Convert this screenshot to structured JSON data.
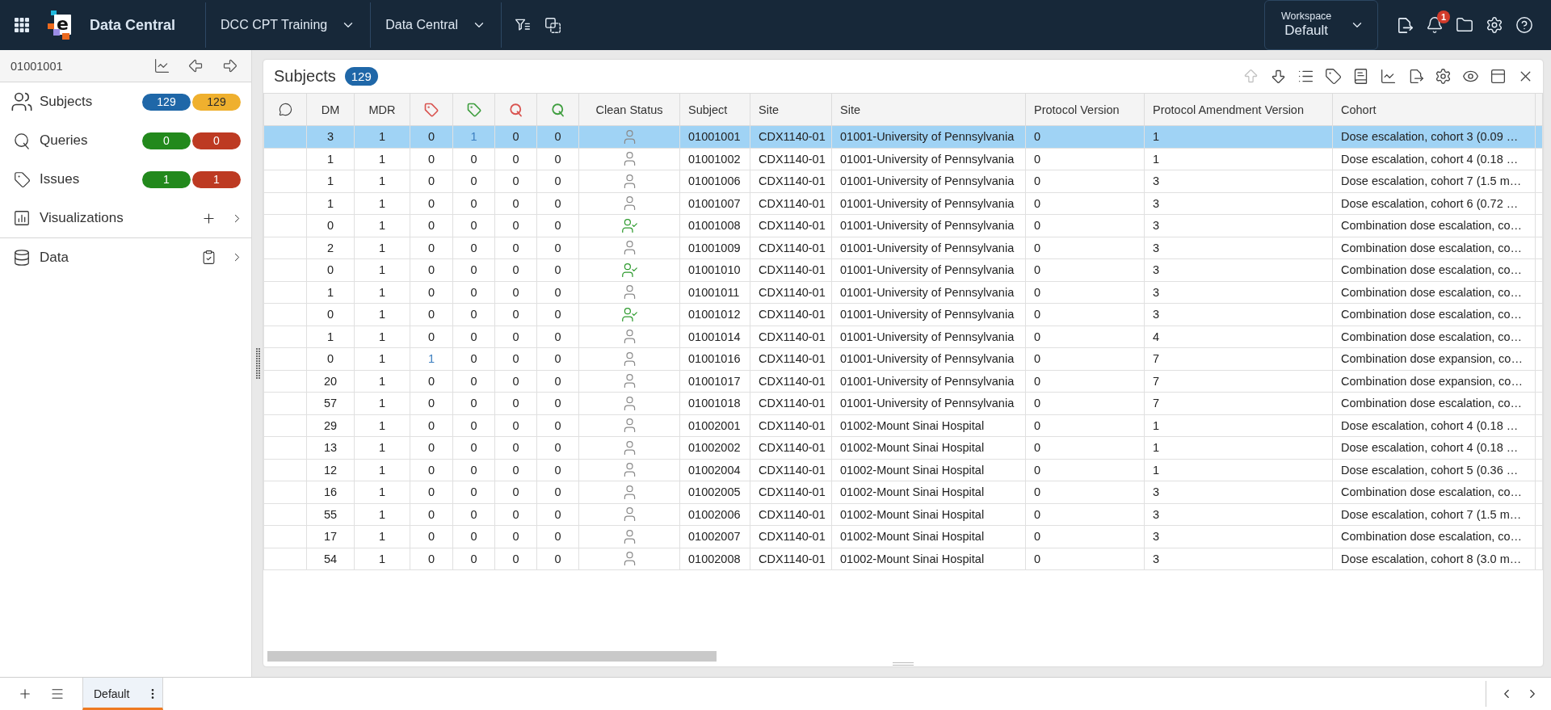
{
  "topbar": {
    "logo_letter": "e",
    "app_name": "Data Central",
    "menus": [
      {
        "label": "DCC CPT Training"
      },
      {
        "label": "Data Central"
      }
    ],
    "workspace": {
      "caption": "Workspace",
      "value": "Default"
    },
    "notification_count": "1"
  },
  "sidebar": {
    "subject_id": "01001001",
    "items": [
      {
        "kind": "subjects",
        "label": "Subjects",
        "badges": [
          {
            "value": "129",
            "color": "#1f67a8"
          },
          {
            "value": "129",
            "color": "#efb02e"
          }
        ]
      },
      {
        "kind": "queries",
        "label": "Queries",
        "badges": [
          {
            "value": "0",
            "color": "#22891c"
          },
          {
            "value": "0",
            "color": "#bd3a22"
          }
        ]
      },
      {
        "kind": "issues",
        "label": "Issues",
        "badges": [
          {
            "value": "1",
            "color": "#22891c"
          },
          {
            "value": "1",
            "color": "#bd3a22"
          }
        ]
      },
      {
        "kind": "visualizations",
        "label": "Visualizations"
      },
      {
        "kind": "data",
        "label": "Data"
      }
    ]
  },
  "panel": {
    "title": "Subjects",
    "count": "129",
    "toolbar": [
      {
        "kind": "up",
        "disabled": true
      },
      {
        "kind": "down",
        "disabled": false
      },
      {
        "kind": "list",
        "disabled": false
      },
      {
        "kind": "tag",
        "disabled": false
      },
      {
        "kind": "book",
        "disabled": false
      },
      {
        "kind": "chart",
        "disabled": false
      },
      {
        "kind": "export",
        "disabled": false
      },
      {
        "kind": "settings",
        "disabled": false
      },
      {
        "kind": "eye",
        "disabled": false
      },
      {
        "kind": "layout",
        "disabled": false
      },
      {
        "kind": "close",
        "disabled": false
      }
    ],
    "table": {
      "columns": [
        {
          "kind": "comment"
        },
        {
          "kind": "text",
          "label": "DM"
        },
        {
          "kind": "text",
          "label": "MDR"
        },
        {
          "kind": "tag",
          "color": "#d9534f"
        },
        {
          "kind": "tag",
          "color": "#3f9e3f"
        },
        {
          "kind": "query",
          "color": "#d9534f"
        },
        {
          "kind": "query",
          "color": "#3f9e3f"
        },
        {
          "kind": "text",
          "label": "Clean Status"
        },
        {
          "kind": "text",
          "label": "Subject"
        },
        {
          "kind": "text",
          "label": "Site"
        },
        {
          "kind": "text",
          "label": "Site"
        },
        {
          "kind": "text",
          "label": "Protocol Version"
        },
        {
          "kind": "text",
          "label": "Protocol Amendment Version"
        },
        {
          "kind": "text",
          "label": "Cohort"
        }
      ],
      "rows": [
        {
          "selected": true,
          "dm": "3",
          "mdr": "1",
          "counts": [
            {
              "value": "0",
              "link": false
            },
            {
              "value": "1",
              "link": true
            },
            {
              "value": "0",
              "link": false
            },
            {
              "value": "0",
              "link": false
            }
          ],
          "clean": false,
          "subject": "01001001",
          "site": "CDX1140-01",
          "site_name": "01001-University of Pennsylvania",
          "protocol_version": "0",
          "amendment_version": "1",
          "cohort": "Dose escalation, cohort 3 (0.09 …"
        },
        {
          "selected": false,
          "dm": "1",
          "mdr": "1",
          "counts": [
            {
              "value": "0",
              "link": false
            },
            {
              "value": "0",
              "link": false
            },
            {
              "value": "0",
              "link": false
            },
            {
              "value": "0",
              "link": false
            }
          ],
          "clean": false,
          "subject": "01001002",
          "site": "CDX1140-01",
          "site_name": "01001-University of Pennsylvania",
          "protocol_version": "0",
          "amendment_version": "1",
          "cohort": "Dose escalation, cohort 4 (0.18 …"
        },
        {
          "selected": false,
          "dm": "1",
          "mdr": "1",
          "counts": [
            {
              "value": "0",
              "link": false
            },
            {
              "value": "0",
              "link": false
            },
            {
              "value": "0",
              "link": false
            },
            {
              "value": "0",
              "link": false
            }
          ],
          "clean": false,
          "subject": "01001006",
          "site": "CDX1140-01",
          "site_name": "01001-University of Pennsylvania",
          "protocol_version": "0",
          "amendment_version": "3",
          "cohort": "Dose escalation, cohort 7 (1.5 m…"
        },
        {
          "selected": false,
          "dm": "1",
          "mdr": "1",
          "counts": [
            {
              "value": "0",
              "link": false
            },
            {
              "value": "0",
              "link": false
            },
            {
              "value": "0",
              "link": false
            },
            {
              "value": "0",
              "link": false
            }
          ],
          "clean": false,
          "subject": "01001007",
          "site": "CDX1140-01",
          "site_name": "01001-University of Pennsylvania",
          "protocol_version": "0",
          "amendment_version": "3",
          "cohort": "Dose escalation, cohort 6 (0.72 …"
        },
        {
          "selected": false,
          "dm": "0",
          "mdr": "1",
          "counts": [
            {
              "value": "0",
              "link": false
            },
            {
              "value": "0",
              "link": false
            },
            {
              "value": "0",
              "link": false
            },
            {
              "value": "0",
              "link": false
            }
          ],
          "clean": true,
          "subject": "01001008",
          "site": "CDX1140-01",
          "site_name": "01001-University of Pennsylvania",
          "protocol_version": "0",
          "amendment_version": "3",
          "cohort": "Combination dose escalation, co…"
        },
        {
          "selected": false,
          "dm": "2",
          "mdr": "1",
          "counts": [
            {
              "value": "0",
              "link": false
            },
            {
              "value": "0",
              "link": false
            },
            {
              "value": "0",
              "link": false
            },
            {
              "value": "0",
              "link": false
            }
          ],
          "clean": false,
          "subject": "01001009",
          "site": "CDX1140-01",
          "site_name": "01001-University of Pennsylvania",
          "protocol_version": "0",
          "amendment_version": "3",
          "cohort": "Combination dose escalation, co…"
        },
        {
          "selected": false,
          "dm": "0",
          "mdr": "1",
          "counts": [
            {
              "value": "0",
              "link": false
            },
            {
              "value": "0",
              "link": false
            },
            {
              "value": "0",
              "link": false
            },
            {
              "value": "0",
              "link": false
            }
          ],
          "clean": true,
          "subject": "01001010",
          "site": "CDX1140-01",
          "site_name": "01001-University of Pennsylvania",
          "protocol_version": "0",
          "amendment_version": "3",
          "cohort": "Combination dose escalation, co…"
        },
        {
          "selected": false,
          "dm": "1",
          "mdr": "1",
          "counts": [
            {
              "value": "0",
              "link": false
            },
            {
              "value": "0",
              "link": false
            },
            {
              "value": "0",
              "link": false
            },
            {
              "value": "0",
              "link": false
            }
          ],
          "clean": false,
          "subject": "01001011",
          "site": "CDX1140-01",
          "site_name": "01001-University of Pennsylvania",
          "protocol_version": "0",
          "amendment_version": "3",
          "cohort": "Combination dose escalation, co…"
        },
        {
          "selected": false,
          "dm": "0",
          "mdr": "1",
          "counts": [
            {
              "value": "0",
              "link": false
            },
            {
              "value": "0",
              "link": false
            },
            {
              "value": "0",
              "link": false
            },
            {
              "value": "0",
              "link": false
            }
          ],
          "clean": true,
          "subject": "01001012",
          "site": "CDX1140-01",
          "site_name": "01001-University of Pennsylvania",
          "protocol_version": "0",
          "amendment_version": "3",
          "cohort": "Combination dose escalation, co…"
        },
        {
          "selected": false,
          "dm": "1",
          "mdr": "1",
          "counts": [
            {
              "value": "0",
              "link": false
            },
            {
              "value": "0",
              "link": false
            },
            {
              "value": "0",
              "link": false
            },
            {
              "value": "0",
              "link": false
            }
          ],
          "clean": false,
          "subject": "01001014",
          "site": "CDX1140-01",
          "site_name": "01001-University of Pennsylvania",
          "protocol_version": "0",
          "amendment_version": "4",
          "cohort": "Combination dose escalation, co…"
        },
        {
          "selected": false,
          "dm": "0",
          "mdr": "1",
          "counts": [
            {
              "value": "1",
              "link": true
            },
            {
              "value": "0",
              "link": false
            },
            {
              "value": "0",
              "link": false
            },
            {
              "value": "0",
              "link": false
            }
          ],
          "clean": false,
          "subject": "01001016",
          "site": "CDX1140-01",
          "site_name": "01001-University of Pennsylvania",
          "protocol_version": "0",
          "amendment_version": "7",
          "cohort": "Combination dose expansion, co…"
        },
        {
          "selected": false,
          "dm": "20",
          "mdr": "1",
          "counts": [
            {
              "value": "0",
              "link": false
            },
            {
              "value": "0",
              "link": false
            },
            {
              "value": "0",
              "link": false
            },
            {
              "value": "0",
              "link": false
            }
          ],
          "clean": false,
          "subject": "01001017",
          "site": "CDX1140-01",
          "site_name": "01001-University of Pennsylvania",
          "protocol_version": "0",
          "amendment_version": "7",
          "cohort": "Combination dose expansion, co…"
        },
        {
          "selected": false,
          "dm": "57",
          "mdr": "1",
          "counts": [
            {
              "value": "0",
              "link": false
            },
            {
              "value": "0",
              "link": false
            },
            {
              "value": "0",
              "link": false
            },
            {
              "value": "0",
              "link": false
            }
          ],
          "clean": false,
          "subject": "01001018",
          "site": "CDX1140-01",
          "site_name": "01001-University of Pennsylvania",
          "protocol_version": "0",
          "amendment_version": "7",
          "cohort": "Combination dose escalation, co…"
        },
        {
          "selected": false,
          "dm": "29",
          "mdr": "1",
          "counts": [
            {
              "value": "0",
              "link": false
            },
            {
              "value": "0",
              "link": false
            },
            {
              "value": "0",
              "link": false
            },
            {
              "value": "0",
              "link": false
            }
          ],
          "clean": false,
          "subject": "01002001",
          "site": "CDX1140-01",
          "site_name": "01002-Mount Sinai Hospital",
          "protocol_version": "0",
          "amendment_version": "1",
          "cohort": "Dose escalation, cohort 4 (0.18 …"
        },
        {
          "selected": false,
          "dm": "13",
          "mdr": "1",
          "counts": [
            {
              "value": "0",
              "link": false
            },
            {
              "value": "0",
              "link": false
            },
            {
              "value": "0",
              "link": false
            },
            {
              "value": "0",
              "link": false
            }
          ],
          "clean": false,
          "subject": "01002002",
          "site": "CDX1140-01",
          "site_name": "01002-Mount Sinai Hospital",
          "protocol_version": "0",
          "amendment_version": "1",
          "cohort": "Dose escalation, cohort 4 (0.18 …"
        },
        {
          "selected": false,
          "dm": "12",
          "mdr": "1",
          "counts": [
            {
              "value": "0",
              "link": false
            },
            {
              "value": "0",
              "link": false
            },
            {
              "value": "0",
              "link": false
            },
            {
              "value": "0",
              "link": false
            }
          ],
          "clean": false,
          "subject": "01002004",
          "site": "CDX1140-01",
          "site_name": "01002-Mount Sinai Hospital",
          "protocol_version": "0",
          "amendment_version": "1",
          "cohort": "Dose escalation, cohort 5 (0.36 …"
        },
        {
          "selected": false,
          "dm": "16",
          "mdr": "1",
          "counts": [
            {
              "value": "0",
              "link": false
            },
            {
              "value": "0",
              "link": false
            },
            {
              "value": "0",
              "link": false
            },
            {
              "value": "0",
              "link": false
            }
          ],
          "clean": false,
          "subject": "01002005",
          "site": "CDX1140-01",
          "site_name": "01002-Mount Sinai Hospital",
          "protocol_version": "0",
          "amendment_version": "3",
          "cohort": "Combination dose escalation, co…"
        },
        {
          "selected": false,
          "dm": "55",
          "mdr": "1",
          "counts": [
            {
              "value": "0",
              "link": false
            },
            {
              "value": "0",
              "link": false
            },
            {
              "value": "0",
              "link": false
            },
            {
              "value": "0",
              "link": false
            }
          ],
          "clean": false,
          "subject": "01002006",
          "site": "CDX1140-01",
          "site_name": "01002-Mount Sinai Hospital",
          "protocol_version": "0",
          "amendment_version": "3",
          "cohort": "Dose escalation, cohort 7 (1.5 m…"
        },
        {
          "selected": false,
          "dm": "17",
          "mdr": "1",
          "counts": [
            {
              "value": "0",
              "link": false
            },
            {
              "value": "0",
              "link": false
            },
            {
              "value": "0",
              "link": false
            },
            {
              "value": "0",
              "link": false
            }
          ],
          "clean": false,
          "subject": "01002007",
          "site": "CDX1140-01",
          "site_name": "01002-Mount Sinai Hospital",
          "protocol_version": "0",
          "amendment_version": "3",
          "cohort": "Combination dose escalation, co…"
        },
        {
          "selected": false,
          "dm": "54",
          "mdr": "1",
          "counts": [
            {
              "value": "0",
              "link": false
            },
            {
              "value": "0",
              "link": false
            },
            {
              "value": "0",
              "link": false
            },
            {
              "value": "0",
              "link": false
            }
          ],
          "clean": false,
          "subject": "01002008",
          "site": "CDX1140-01",
          "site_name": "01002-Mount Sinai Hospital",
          "protocol_version": "0",
          "amendment_version": "3",
          "cohort": "Dose escalation, cohort 8 (3.0 m…"
        }
      ]
    }
  },
  "bottom_bar": {
    "tabs": [
      {
        "label": "Default",
        "selected": true
      }
    ]
  }
}
